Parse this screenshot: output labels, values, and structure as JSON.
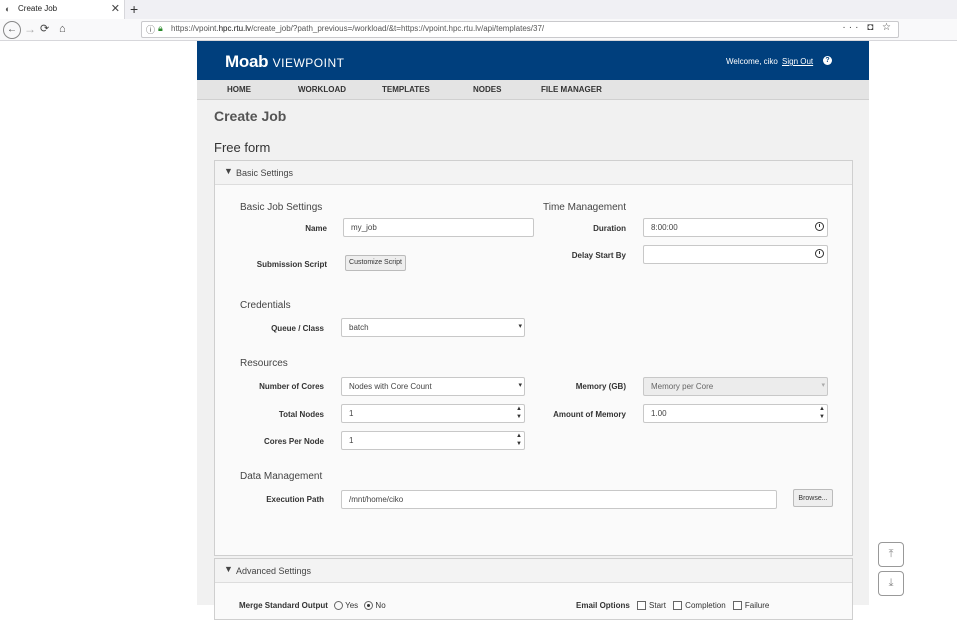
{
  "browser": {
    "tab_title": "Create Job",
    "url_prefix": "https://vpoint.",
    "url_domain": "hpc.rtu.lv",
    "url_rest": "/create_job/?path_previous=/workload/&t=https://vpoint.hpc.rtu.lv/api/templates/37/",
    "menu_dots": "···"
  },
  "header": {
    "logo_bold": "Moab",
    "logo_light": "VIEWPOINT",
    "welcome": "Welcome, ciko",
    "sign_out": "Sign Out",
    "help": "?"
  },
  "nav": [
    "HOME",
    "WORKLOAD",
    "TEMPLATES",
    "NODES",
    "FILE MANAGER"
  ],
  "page_title": "Create Job",
  "form_title": "Free form",
  "basic": {
    "title": "Basic Settings",
    "job_settings": "Basic Job Settings",
    "name_label": "Name",
    "name_value": "my_job",
    "submission_label": "Submission Script",
    "customize_button": "Customize Script",
    "time_mgmt": "Time Management",
    "duration_label": "Duration",
    "duration_value": "8:00:00",
    "delay_label": "Delay Start By",
    "delay_value": "",
    "credentials": "Credentials",
    "queue_label": "Queue / Class",
    "queue_value": "batch",
    "resources": "Resources",
    "cores_label": "Number of Cores",
    "cores_value": "Nodes with Core Count",
    "memory_label": "Memory (GB)",
    "memory_value": "Memory per Core",
    "total_nodes_label": "Total Nodes",
    "total_nodes_value": "1",
    "amount_mem_label": "Amount of Memory",
    "amount_mem_value": "1.00",
    "cpn_label": "Cores Per Node",
    "cpn_value": "1",
    "data_mgmt": "Data Management",
    "exec_label": "Execution Path",
    "exec_value": "/mnt/home/ciko",
    "browse_button": "Browse..."
  },
  "advanced": {
    "title": "Advanced Settings",
    "merge_label": "Merge Standard Output",
    "yes": "Yes",
    "no": "No",
    "email_label": "Email Options",
    "start": "Start",
    "completion": "Completion",
    "failure": "Failure"
  }
}
